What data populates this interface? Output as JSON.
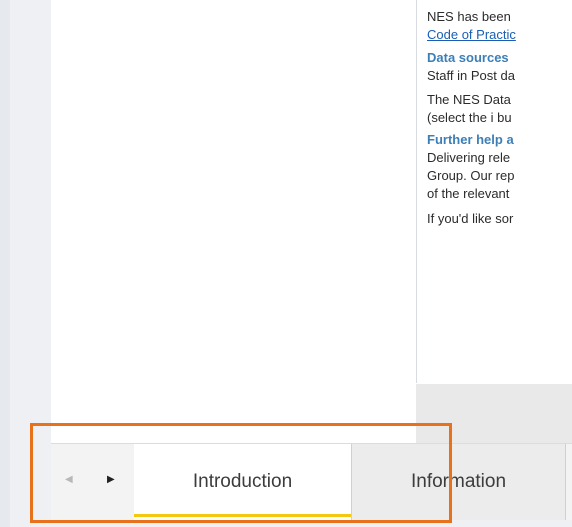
{
  "text_panel": {
    "line1": "NES has been",
    "link_text": "Code of Practic",
    "heading_data_sources": "Data sources",
    "line_staff": "Staff in Post da",
    "line_nes_data": "The NES Data",
    "line_select": "(select the i bu",
    "heading_further_help": "Further help a",
    "line_delivering": "Delivering rele",
    "line_group": "Group. Our rep",
    "line_relevant": "of the relevant",
    "line_if_like": "If you'd like sor"
  },
  "tabs": {
    "prev_arrow": "◀",
    "next_arrow": "▶",
    "items": [
      {
        "label": "Introduction",
        "active": true
      },
      {
        "label": "Information",
        "active": false
      }
    ]
  },
  "colors": {
    "highlight": "#e8711b",
    "active_underline": "#f2c811",
    "heading": "#3c7fb6",
    "link": "#1a5fb4"
  }
}
